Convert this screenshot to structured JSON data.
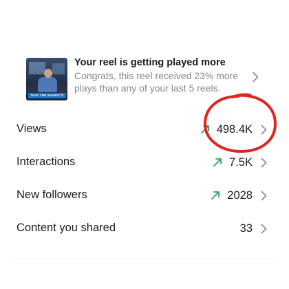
{
  "reel": {
    "title": "Your reel is getting played more",
    "description": "Congrats, this reel received 23% more plays than any of your last 5 reels.",
    "thumbnail_banner": "THAT THE MARKETS"
  },
  "stats": [
    {
      "label": "Views",
      "value": "498.4K",
      "trend": "up",
      "trend_icon": "trend-up-arrow-icon"
    },
    {
      "label": "Interactions",
      "value": "7.5K",
      "trend": "up",
      "trend_icon": "trend-up-arrow-icon"
    },
    {
      "label": "New followers",
      "value": "2028",
      "trend": "up",
      "trend_icon": "trend-up-arrow-icon"
    },
    {
      "label": "Content you shared",
      "value": "33",
      "trend": null
    }
  ],
  "colors": {
    "trend_up": "#2e9e5b",
    "annotation": "#e0241f",
    "secondary_text": "#86868b",
    "chevron": "#8e8e93"
  },
  "icons": {
    "chevron": "chevron-right-icon"
  }
}
